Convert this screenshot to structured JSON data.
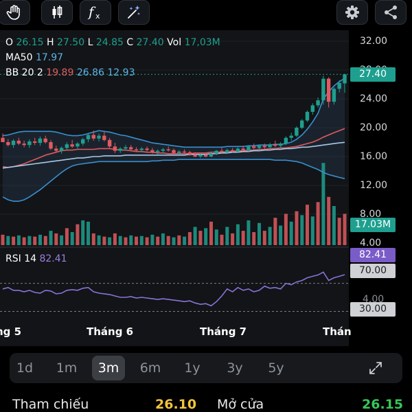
{
  "toolbar": {
    "left_icons": [
      "hand-icon",
      "candlestick-icon",
      "function-icon",
      "magic-draw-icon"
    ],
    "right_icons": [
      "gear-icon",
      "share-icon"
    ]
  },
  "legend": {
    "o_label": "O",
    "o_value": "26.15",
    "h_label": "H",
    "h_value": "27.50",
    "l_label": "L",
    "l_value": "24.85",
    "c_label": "C",
    "c_value": "27.40",
    "vol_label": "Vol",
    "vol_value": "17,03M",
    "ma_label": "MA50",
    "ma_value": "17.97",
    "bb_label": "BB 20 2",
    "bb_upper": "19.89",
    "bb_mid": "26.86",
    "bb_lower": "12.93",
    "rsi_label": "RSI 14",
    "rsi_value": "82.41"
  },
  "price_axis": [
    "32.00",
    "28.00",
    "24.00",
    "20.00",
    "16.00",
    "12.00",
    "8.00",
    "4.00"
  ],
  "badges": {
    "last_price": "27.40",
    "volume": "17.03M",
    "rsi_value": "82.41",
    "rsi_upper": "70.00",
    "rsi_mid": "4.00",
    "rsi_lower": "30.00"
  },
  "months": [
    "ng 5",
    "Tháng 6",
    "Tháng 7",
    "Thán"
  ],
  "periods": {
    "items": [
      "1d",
      "1m",
      "3m",
      "6m",
      "1y",
      "3y",
      "5y"
    ],
    "active": "3m",
    "expand_icon": "expand-icon"
  },
  "bottom": {
    "ref_label": "Tham chiếu",
    "ref_value": "26.10",
    "open_label": "Mở cửa",
    "open_value": "26.15"
  },
  "colors": {
    "up": "#1e9f8f",
    "down": "#e05a60",
    "ma": "#a9c8e8",
    "bb_band": "#3a8fd1",
    "rsi": "#8a73d9",
    "ref": "#f3c43b",
    "open": "#35c759"
  },
  "chart_data": {
    "type": "candlestick",
    "ylim": [
      4,
      32
    ],
    "y_ticks": [
      32,
      28,
      24,
      20,
      16,
      12,
      8,
      4
    ],
    "last_price": 27.4,
    "candles": [
      [
        18.6,
        19.2,
        18.0,
        18.0
      ],
      [
        18.0,
        18.4,
        17.4,
        17.6
      ],
      [
        17.6,
        18.4,
        17.2,
        18.2
      ],
      [
        18.2,
        18.6,
        17.6,
        17.8
      ],
      [
        17.8,
        18.2,
        17.3,
        17.6
      ],
      [
        17.6,
        18.4,
        17.2,
        18.1
      ],
      [
        18.1,
        18.6,
        17.6,
        17.9
      ],
      [
        17.9,
        18.8,
        17.5,
        18.5
      ],
      [
        18.5,
        18.9,
        17.8,
        18.0
      ],
      [
        18.0,
        18.3,
        16.9,
        17.1
      ],
      [
        17.1,
        17.5,
        16.6,
        16.8
      ],
      [
        16.8,
        17.4,
        16.4,
        17.2
      ],
      [
        17.2,
        18.0,
        16.9,
        17.7
      ],
      [
        17.7,
        18.3,
        17.2,
        17.4
      ],
      [
        17.4,
        18.0,
        17.0,
        17.8
      ],
      [
        17.8,
        18.6,
        17.5,
        18.4
      ],
      [
        18.4,
        19.2,
        18.0,
        19.0
      ],
      [
        19.0,
        19.6,
        18.2,
        18.5
      ],
      [
        18.5,
        19.2,
        18.1,
        18.9
      ],
      [
        18.9,
        19.5,
        18.1,
        18.3
      ],
      [
        18.3,
        18.6,
        17.2,
        17.4
      ],
      [
        17.4,
        17.9,
        16.5,
        16.8
      ],
      [
        16.8,
        17.3,
        16.5,
        17.1
      ],
      [
        17.1,
        17.6,
        16.9,
        17.3
      ],
      [
        17.3,
        17.6,
        16.8,
        17.0
      ],
      [
        17.0,
        17.3,
        16.7,
        16.9
      ],
      [
        16.9,
        17.3,
        16.6,
        17.1
      ],
      [
        17.1,
        17.4,
        16.7,
        16.9
      ],
      [
        16.9,
        17.2,
        16.4,
        16.6
      ],
      [
        16.6,
        17.0,
        16.3,
        16.8
      ],
      [
        16.8,
        17.2,
        16.5,
        17.0
      ],
      [
        17.0,
        17.4,
        16.7,
        16.9
      ],
      [
        16.9,
        17.1,
        16.4,
        16.5
      ],
      [
        16.5,
        16.9,
        16.3,
        16.7
      ],
      [
        16.7,
        17.0,
        16.4,
        16.6
      ],
      [
        16.6,
        16.8,
        16.1,
        16.3
      ],
      [
        16.3,
        16.6,
        15.9,
        16.0
      ],
      [
        16.0,
        16.4,
        15.8,
        16.2
      ],
      [
        16.2,
        16.5,
        15.9,
        16.0
      ],
      [
        16.0,
        16.6,
        15.9,
        16.4
      ],
      [
        16.4,
        16.9,
        16.2,
        16.8
      ],
      [
        16.8,
        17.2,
        16.5,
        16.6
      ],
      [
        16.6,
        17.1,
        16.4,
        16.9
      ],
      [
        16.9,
        17.2,
        16.6,
        16.7
      ],
      [
        16.7,
        17.3,
        16.5,
        17.1
      ],
      [
        17.1,
        17.5,
        16.8,
        16.9
      ],
      [
        16.9,
        17.6,
        16.7,
        17.4
      ],
      [
        17.4,
        17.8,
        17.0,
        17.2
      ],
      [
        17.2,
        17.6,
        16.9,
        17.5
      ],
      [
        17.5,
        17.8,
        17.1,
        17.3
      ],
      [
        17.3,
        17.9,
        17.1,
        17.7
      ],
      [
        17.7,
        18.2,
        17.3,
        17.5
      ],
      [
        17.5,
        18.0,
        17.2,
        17.8
      ],
      [
        17.8,
        18.8,
        17.6,
        18.6
      ],
      [
        18.6,
        19.3,
        18.2,
        18.9
      ],
      [
        18.9,
        20.2,
        18.7,
        20.0
      ],
      [
        20.0,
        21.2,
        19.8,
        21.0
      ],
      [
        21.0,
        22.4,
        20.8,
        22.2
      ],
      [
        22.2,
        23.4,
        21.8,
        23.1
      ],
      [
        23.1,
        24.2,
        22.8,
        23.8
      ],
      [
        23.8,
        27.2,
        23.2,
        26.8
      ],
      [
        26.8,
        27.0,
        22.8,
        23.6
      ],
      [
        23.6,
        25.6,
        23.2,
        25.4
      ],
      [
        25.4,
        26.6,
        24.9,
        26.2
      ],
      [
        26.15,
        27.5,
        24.85,
        27.4
      ]
    ],
    "volume": [
      [
        1.6,
        0
      ],
      [
        1.4,
        1
      ],
      [
        1.3,
        0
      ],
      [
        1.5,
        1
      ],
      [
        1.2,
        0
      ],
      [
        1.4,
        1
      ],
      [
        1.3,
        0
      ],
      [
        1.6,
        1
      ],
      [
        1.4,
        0
      ],
      [
        2.2,
        1
      ],
      [
        1.8,
        0
      ],
      [
        1.5,
        1
      ],
      [
        2.6,
        0
      ],
      [
        2.0,
        1
      ],
      [
        3.2,
        0
      ],
      [
        3.8,
        1
      ],
      [
        3.6,
        1
      ],
      [
        1.8,
        0
      ],
      [
        1.5,
        1
      ],
      [
        1.3,
        0
      ],
      [
        1.2,
        1
      ],
      [
        1.8,
        0
      ],
      [
        1.4,
        1
      ],
      [
        1.2,
        0
      ],
      [
        1.5,
        1
      ],
      [
        1.3,
        0
      ],
      [
        1.4,
        1
      ],
      [
        1.2,
        0
      ],
      [
        1.6,
        1
      ],
      [
        1.3,
        0
      ],
      [
        1.8,
        1
      ],
      [
        1.4,
        0
      ],
      [
        1.2,
        1
      ],
      [
        1.5,
        0
      ],
      [
        1.3,
        1
      ],
      [
        2.0,
        0
      ],
      [
        2.8,
        1
      ],
      [
        2.2,
        0
      ],
      [
        2.6,
        1
      ],
      [
        3.6,
        0
      ],
      [
        2.4,
        1
      ],
      [
        1.6,
        0
      ],
      [
        2.8,
        1
      ],
      [
        1.8,
        0
      ],
      [
        3.2,
        1
      ],
      [
        2.2,
        0
      ],
      [
        3.8,
        1
      ],
      [
        2.0,
        0
      ],
      [
        3.4,
        1
      ],
      [
        2.2,
        0
      ],
      [
        2.8,
        1
      ],
      [
        4.2,
        0
      ],
      [
        3.0,
        1
      ],
      [
        4.8,
        0
      ],
      [
        3.6,
        1
      ],
      [
        5.2,
        0
      ],
      [
        4.6,
        1
      ],
      [
        6.2,
        0
      ],
      [
        4.4,
        1
      ],
      [
        6.6,
        0
      ],
      [
        12.6,
        1
      ],
      [
        7.4,
        0
      ],
      [
        6.0,
        1
      ],
      [
        4.2,
        0
      ],
      [
        4.8,
        0
      ]
    ],
    "ma50": [
      14.4,
      14.5,
      14.6,
      14.7,
      14.8,
      14.9,
      15.0,
      15.1,
      15.2,
      15.3,
      15.4,
      15.5,
      15.6,
      15.7,
      15.8,
      15.8,
      15.9,
      16.0,
      16.0,
      16.1,
      16.1,
      16.1,
      16.1,
      16.2,
      16.2,
      16.2,
      16.2,
      16.2,
      16.2,
      16.2,
      16.2,
      16.2,
      16.2,
      16.2,
      16.2,
      16.3,
      16.3,
      16.3,
      16.3,
      16.4,
      16.4,
      16.5,
      16.5,
      16.6,
      16.6,
      16.7,
      16.7,
      16.8,
      16.8,
      16.9,
      16.9,
      17.0,
      17.0,
      17.1,
      17.1,
      17.2,
      17.3,
      17.3,
      17.4,
      17.5,
      17.6,
      17.7,
      17.8,
      17.9,
      17.97
    ],
    "bb_upper": [
      18.9,
      19.0,
      19.2,
      19.4,
      19.5,
      19.5,
      19.5,
      19.5,
      19.5,
      19.5,
      19.4,
      19.2,
      19.0,
      18.9,
      18.9,
      19.0,
      19.2,
      19.4,
      19.6,
      19.5,
      19.4,
      19.2,
      19.0,
      18.9,
      18.7,
      18.5,
      18.3,
      18.1,
      17.9,
      17.8,
      17.7,
      17.6,
      17.5,
      17.4,
      17.3,
      17.3,
      17.3,
      17.3,
      17.3,
      17.3,
      17.3,
      17.3,
      17.4,
      17.4,
      17.4,
      17.4,
      17.5,
      17.5,
      17.6,
      17.6,
      17.6,
      17.7,
      17.7,
      17.8,
      18.0,
      18.4,
      19.0,
      19.8,
      20.8,
      22.0,
      24.0,
      25.0,
      25.8,
      26.4,
      26.86
    ],
    "bb_mid": [
      14.6,
      14.5,
      14.6,
      14.8,
      15.0,
      15.3,
      15.6,
      15.9,
      16.2,
      16.4,
      16.6,
      16.8,
      16.9,
      16.9,
      17.0,
      17.0,
      17.0,
      17.0,
      17.1,
      17.1,
      17.1,
      17.0,
      16.9,
      16.9,
      16.8,
      16.7,
      16.7,
      16.6,
      16.6,
      16.5,
      16.5,
      16.4,
      16.4,
      16.4,
      16.4,
      16.4,
      16.5,
      16.5,
      16.5,
      16.6,
      16.6,
      16.6,
      16.7,
      16.7,
      16.8,
      16.8,
      16.9,
      16.9,
      17.0,
      17.0,
      17.1,
      17.1,
      17.2,
      17.2,
      17.3,
      17.4,
      17.6,
      17.8,
      18.0,
      18.3,
      18.7,
      19.0,
      19.3,
      19.6,
      19.89
    ],
    "bb_lower": [
      10.4,
      10.0,
      9.8,
      9.8,
      10.0,
      10.4,
      10.9,
      11.4,
      12.0,
      12.6,
      13.2,
      13.8,
      14.3,
      14.7,
      14.9,
      15.0,
      15.1,
      15.2,
      15.3,
      15.3,
      15.3,
      15.3,
      15.3,
      15.3,
      15.3,
      15.3,
      15.3,
      15.3,
      15.4,
      15.4,
      15.5,
      15.5,
      15.5,
      15.6,
      15.6,
      15.6,
      15.6,
      15.6,
      15.6,
      15.6,
      15.6,
      15.6,
      15.6,
      15.6,
      15.6,
      15.6,
      15.6,
      15.6,
      15.6,
      15.6,
      15.6,
      15.5,
      15.5,
      15.5,
      15.4,
      15.3,
      15.1,
      14.8,
      14.5,
      14.2,
      13.8,
      13.5,
      13.3,
      13.1,
      12.93
    ],
    "rsi": [
      62,
      64,
      60,
      60,
      58,
      60,
      57,
      56,
      60,
      59,
      55,
      56,
      60,
      61,
      60,
      63,
      64,
      58,
      56,
      55,
      54,
      52,
      50,
      50,
      51,
      49,
      50,
      49,
      48,
      47,
      48,
      47,
      46,
      45,
      44,
      45,
      42,
      40,
      41,
      38,
      44,
      52,
      62,
      58,
      64,
      60,
      62,
      58,
      60,
      66,
      63,
      64,
      62,
      70,
      68,
      72,
      74,
      78,
      80,
      82,
      86,
      74,
      78,
      80,
      82.41
    ]
  }
}
